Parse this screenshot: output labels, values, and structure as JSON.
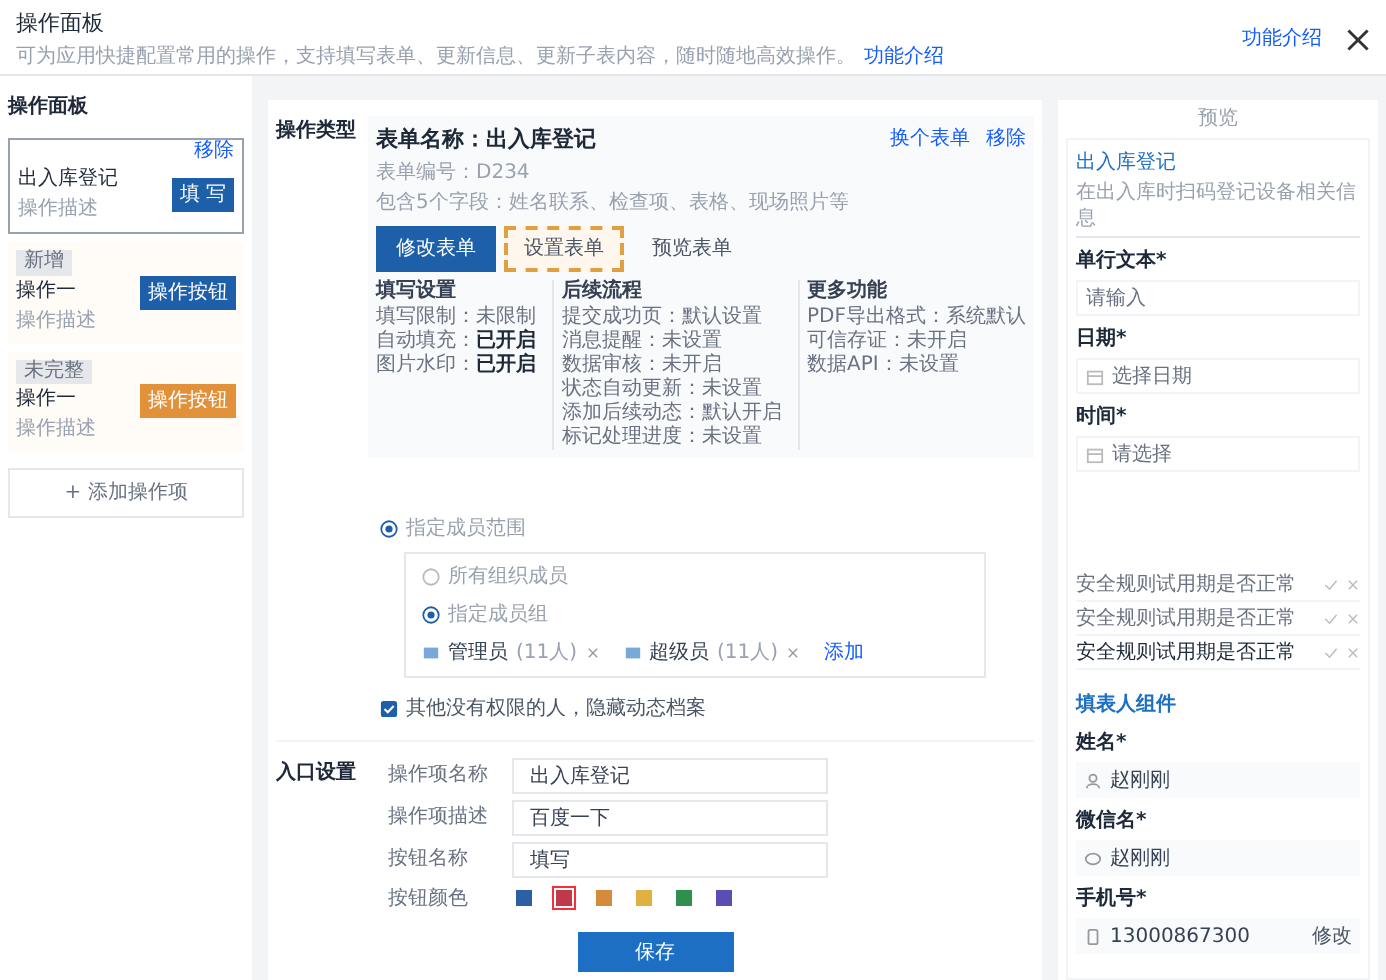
{
  "header": {
    "title": "操作面板",
    "description": "可为应用快捷配置常用的操作，支持填写表单、更新信息、更新子表内容，随时随地高效操作。",
    "description_link": "功能介绍",
    "help_link": "功能介绍"
  },
  "sidebar": {
    "title": "操作面板",
    "items": [
      {
        "name": "出入库登记",
        "desc": "操作描述",
        "button": "填 写",
        "color": "#1d5fa8",
        "selected": true,
        "remove": "移除"
      },
      {
        "tag": "新增",
        "name": "操作一",
        "desc": "操作描述",
        "button": "操作按钮",
        "color": "#1d5fa8",
        "selected": false
      },
      {
        "tag": "未完整",
        "name": "操作一",
        "desc": "操作描述",
        "button": "操作按钮",
        "color": "#e0913a",
        "selected": false
      }
    ],
    "add_button": "+ 添加操作项"
  },
  "config": {
    "section_label": "操作类型",
    "form_title": "表单名称：出入库登记",
    "form_code": "表单编号：D234",
    "form_fields": "包含5个字段：姓名联系、检查项、表格、现场照片等",
    "links": [
      "换个表单",
      "移除"
    ],
    "buttons": [
      {
        "label": "修改表单",
        "kind": "primary",
        "highlighted": false
      },
      {
        "label": "设置表单",
        "kind": "plain",
        "highlighted": true
      },
      {
        "label": "预览表单",
        "kind": "plain",
        "highlighted": false
      }
    ],
    "columns": [
      {
        "title": "填写设置",
        "rows": [
          {
            "label": "填写限制：",
            "value": "未限制",
            "strong": false
          },
          {
            "label": "自动填充：",
            "value": "已开启",
            "strong": true
          },
          {
            "label": "图片水印：",
            "value": "已开启",
            "strong": true
          }
        ]
      },
      {
        "title": "后续流程",
        "rows": [
          {
            "label": "提交成功页：",
            "value": "默认设置",
            "strong": false
          },
          {
            "label": "消息提醒：",
            "value": "未设置",
            "strong": false
          },
          {
            "label": "数据审核：",
            "value": "未开启",
            "strong": false
          },
          {
            "label": "状态自动更新：",
            "value": "未设置",
            "strong": false
          },
          {
            "label": "添加后续动态：",
            "value": "默认开启",
            "strong": false
          },
          {
            "label": "标记处理进度：",
            "value": "未设置",
            "strong": false
          }
        ]
      },
      {
        "title": "更多功能",
        "rows": [
          {
            "label": "PDF导出格式：",
            "value": "系统默认",
            "strong": false
          },
          {
            "label": "可信存证：",
            "value": "未开启",
            "strong": false
          },
          {
            "label": "数据API：",
            "value": "未设置",
            "strong": false
          }
        ]
      }
    ]
  },
  "permission": {
    "scope": {
      "label": "指定成员范围",
      "selected": true
    },
    "options": [
      {
        "label": "所有组织成员",
        "selected": false
      },
      {
        "label": "指定成员组",
        "selected": true
      }
    ],
    "chips": [
      {
        "name": "管理员",
        "count": "(11人)"
      },
      {
        "name": "超级员",
        "count": "(11人)"
      }
    ],
    "add_link": "添加",
    "hide_others": {
      "label": "其他没有权限的人，隐藏动态档案",
      "checked": true
    }
  },
  "entry": {
    "section_label": "入口设置",
    "fields": [
      {
        "label": "操作项名称",
        "value": "出入库登记"
      },
      {
        "label": "操作项描述",
        "value": "百度一下"
      },
      {
        "label": "按钮名称",
        "value": "填写"
      }
    ],
    "color_label": "按钮颜色",
    "colors": [
      {
        "color": "#2d5fa6",
        "selected": false
      },
      {
        "color": "#c0394b",
        "selected": true
      },
      {
        "color": "#d58b3c",
        "selected": false
      },
      {
        "color": "#e0b040",
        "selected": false
      },
      {
        "color": "#2f8f4e",
        "selected": false
      },
      {
        "color": "#5a4fb0",
        "selected": false
      }
    ]
  },
  "save_button": "保存",
  "preview": {
    "label": "预览",
    "title": "出入库登记",
    "desc": "在出入库时扫码登记设备相关信息",
    "fields": [
      {
        "label": "单行文本*",
        "placeholder": "请输入",
        "kind": "text"
      },
      {
        "label": "日期*",
        "placeholder": "选择日期",
        "kind": "date"
      },
      {
        "label": "时间*",
        "placeholder": "请选择",
        "kind": "date"
      }
    ],
    "options": [
      {
        "label": "安全规则试用期是否正常",
        "active": false
      },
      {
        "label": "安全规则试用期是否正常",
        "active": false
      },
      {
        "label": "安全规则试用期是否正常",
        "active": true
      }
    ],
    "section": "填表人组件",
    "person_fields": [
      {
        "label": "姓名*",
        "value": "赵刚刚",
        "kind": "user"
      },
      {
        "label": "微信名*",
        "value": "赵刚刚",
        "kind": "wechat"
      },
      {
        "label": "手机号*",
        "value": "13000867300",
        "kind": "phone",
        "action": "修改"
      }
    ]
  }
}
